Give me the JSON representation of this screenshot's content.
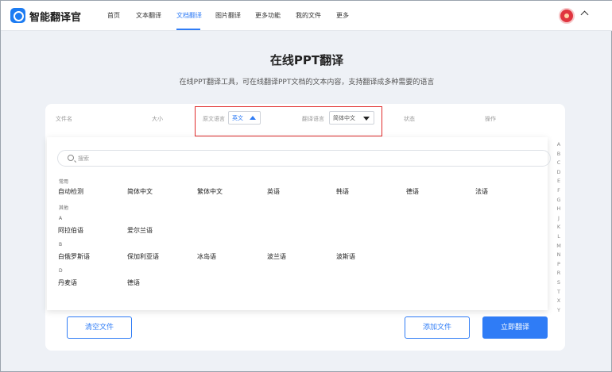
{
  "header": {
    "brand": "智能翻译官",
    "nav": [
      "首页",
      "文本翻译",
      "文档翻译",
      "图片翻译",
      "更多功能",
      "我的文件",
      "更多"
    ],
    "active_nav": "文档翻译"
  },
  "page": {
    "title": "在线PPT翻译",
    "subtitle": "在线PPT翻译工具，可在线翻译PPT文档的文本内容，支持翻译成多种需要的语言"
  },
  "table_header": {
    "file_name": "文件名",
    "size": "大小",
    "source_lang_label": "原文语言",
    "source_lang_value": "英文",
    "target_lang_label": "翻译语言",
    "target_lang_value": "简体中文",
    "status": "状态",
    "action": "操作"
  },
  "dropdown": {
    "search_placeholder": "搜索",
    "groups": {
      "common": {
        "label": "常用",
        "items": [
          "自动检测",
          "简体中文",
          "繁体中文",
          "英语",
          "韩语",
          "德语",
          "法语"
        ]
      },
      "other_label": "其他",
      "A": {
        "label": "A",
        "items": [
          "阿拉伯语",
          "爱尔兰语"
        ]
      },
      "B": {
        "label": "B",
        "items": [
          "白俄罗斯语",
          "保加利亚语",
          "冰岛语",
          "波兰语",
          "波斯语"
        ]
      },
      "D": {
        "label": "D",
        "items": [
          "丹麦语",
          "德语"
        ]
      }
    }
  },
  "alphabet": [
    "A",
    "B",
    "C",
    "D",
    "E",
    "F",
    "G",
    "H",
    "J",
    "K",
    "L",
    "M",
    "N",
    "P",
    "R",
    "S",
    "T",
    "X",
    "Y"
  ],
  "buttons": {
    "clear": "清空文件",
    "add": "添加文件",
    "translate": "立即翻译"
  },
  "colors": {
    "accent": "#2f7cf6",
    "highlight_frame": "#e02b2b"
  }
}
